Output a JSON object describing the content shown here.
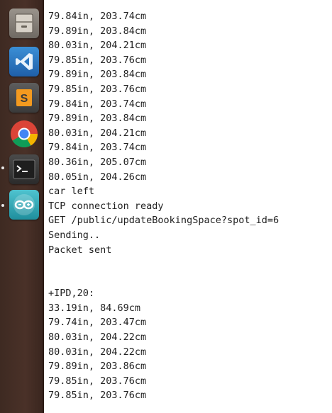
{
  "launcher": {
    "items": [
      {
        "name": "files-icon"
      },
      {
        "name": "vscode-icon"
      },
      {
        "name": "sublime-text-icon"
      },
      {
        "name": "chrome-icon"
      },
      {
        "name": "terminal-icon"
      },
      {
        "name": "arduino-icon"
      }
    ],
    "colors": {
      "background": "#42302a",
      "arduino": "#2fa6b5"
    }
  },
  "serial_monitor": {
    "lines": [
      "79.84in, 203.74cm",
      "79.89in, 203.84cm",
      "80.03in, 204.21cm",
      "79.85in, 203.76cm",
      "79.89in, 203.84cm",
      "79.85in, 203.76cm",
      "79.84in, 203.74cm",
      "79.89in, 203.84cm",
      "80.03in, 204.21cm",
      "79.84in, 203.74cm",
      "80.36in, 205.07cm",
      "80.05in, 204.26cm",
      "car left",
      "TCP connection ready",
      "GET /public/updateBookingSpace?spot_id=6",
      "Sending..",
      "Packet sent",
      "",
      "",
      "+IPD,20:",
      "33.19in, 84.69cm",
      "79.74in, 203.47cm",
      "80.03in, 204.22cm",
      "80.03in, 204.22cm",
      "79.89in, 203.86cm",
      "79.85in, 203.76cm",
      "79.85in, 203.76cm"
    ]
  }
}
